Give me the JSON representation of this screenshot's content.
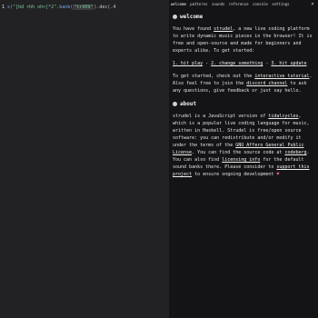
{
  "editor": {
    "line_number": "1",
    "code_prefix": "s(",
    "code_string": "\"[bd <hh oh>]*2\"",
    "code_call": ".bank(",
    "code_bank": "\"tr909\"",
    "code_suffix": ").dec(.4"
  },
  "panel": {
    "tabs": [
      "welcome",
      "patterns",
      "sounds",
      "reference",
      "console",
      "settings"
    ],
    "close_glyph": "×",
    "welcome": {
      "title": "welcome",
      "p1_a": "You have found ",
      "p1_link": "strudel",
      "p1_b": ", a new live coding platform to write dynamic music pieces in the browser! It is free and open-source and made for beginners and experts alike. To get started:",
      "steps": [
        "1. hit play",
        " - ",
        "2. change something",
        " - ",
        "3. hit update"
      ],
      "p2_a": "To get started, check out the ",
      "p2_link1": "interactive tutorial",
      "p2_b": ". Also feel free to join the ",
      "p2_link2": "discord channel",
      "p2_c": " to ask any questions, give feedback or just say hello."
    },
    "about": {
      "title": "about",
      "p1_a": "strudel is a JavaScript version of ",
      "p1_link1": "tidalcycles",
      "p1_b": ", which is a popular live coding language for music, written in Haskell. Strudel is free/open source software: you can redistribute and/or modify it under the terms of the ",
      "p1_link2": "GNU Affero General Public License",
      "p1_c": ". You can find the source code at ",
      "p1_link3": "codeberg",
      "p1_d": ". You can also find ",
      "p1_link4": "licensing info",
      "p1_e": " for the default sound banks there. Please consider to ",
      "p1_link5": "support this project",
      "p1_f": " to ensure ongoing development ",
      "heart": "♥"
    }
  }
}
